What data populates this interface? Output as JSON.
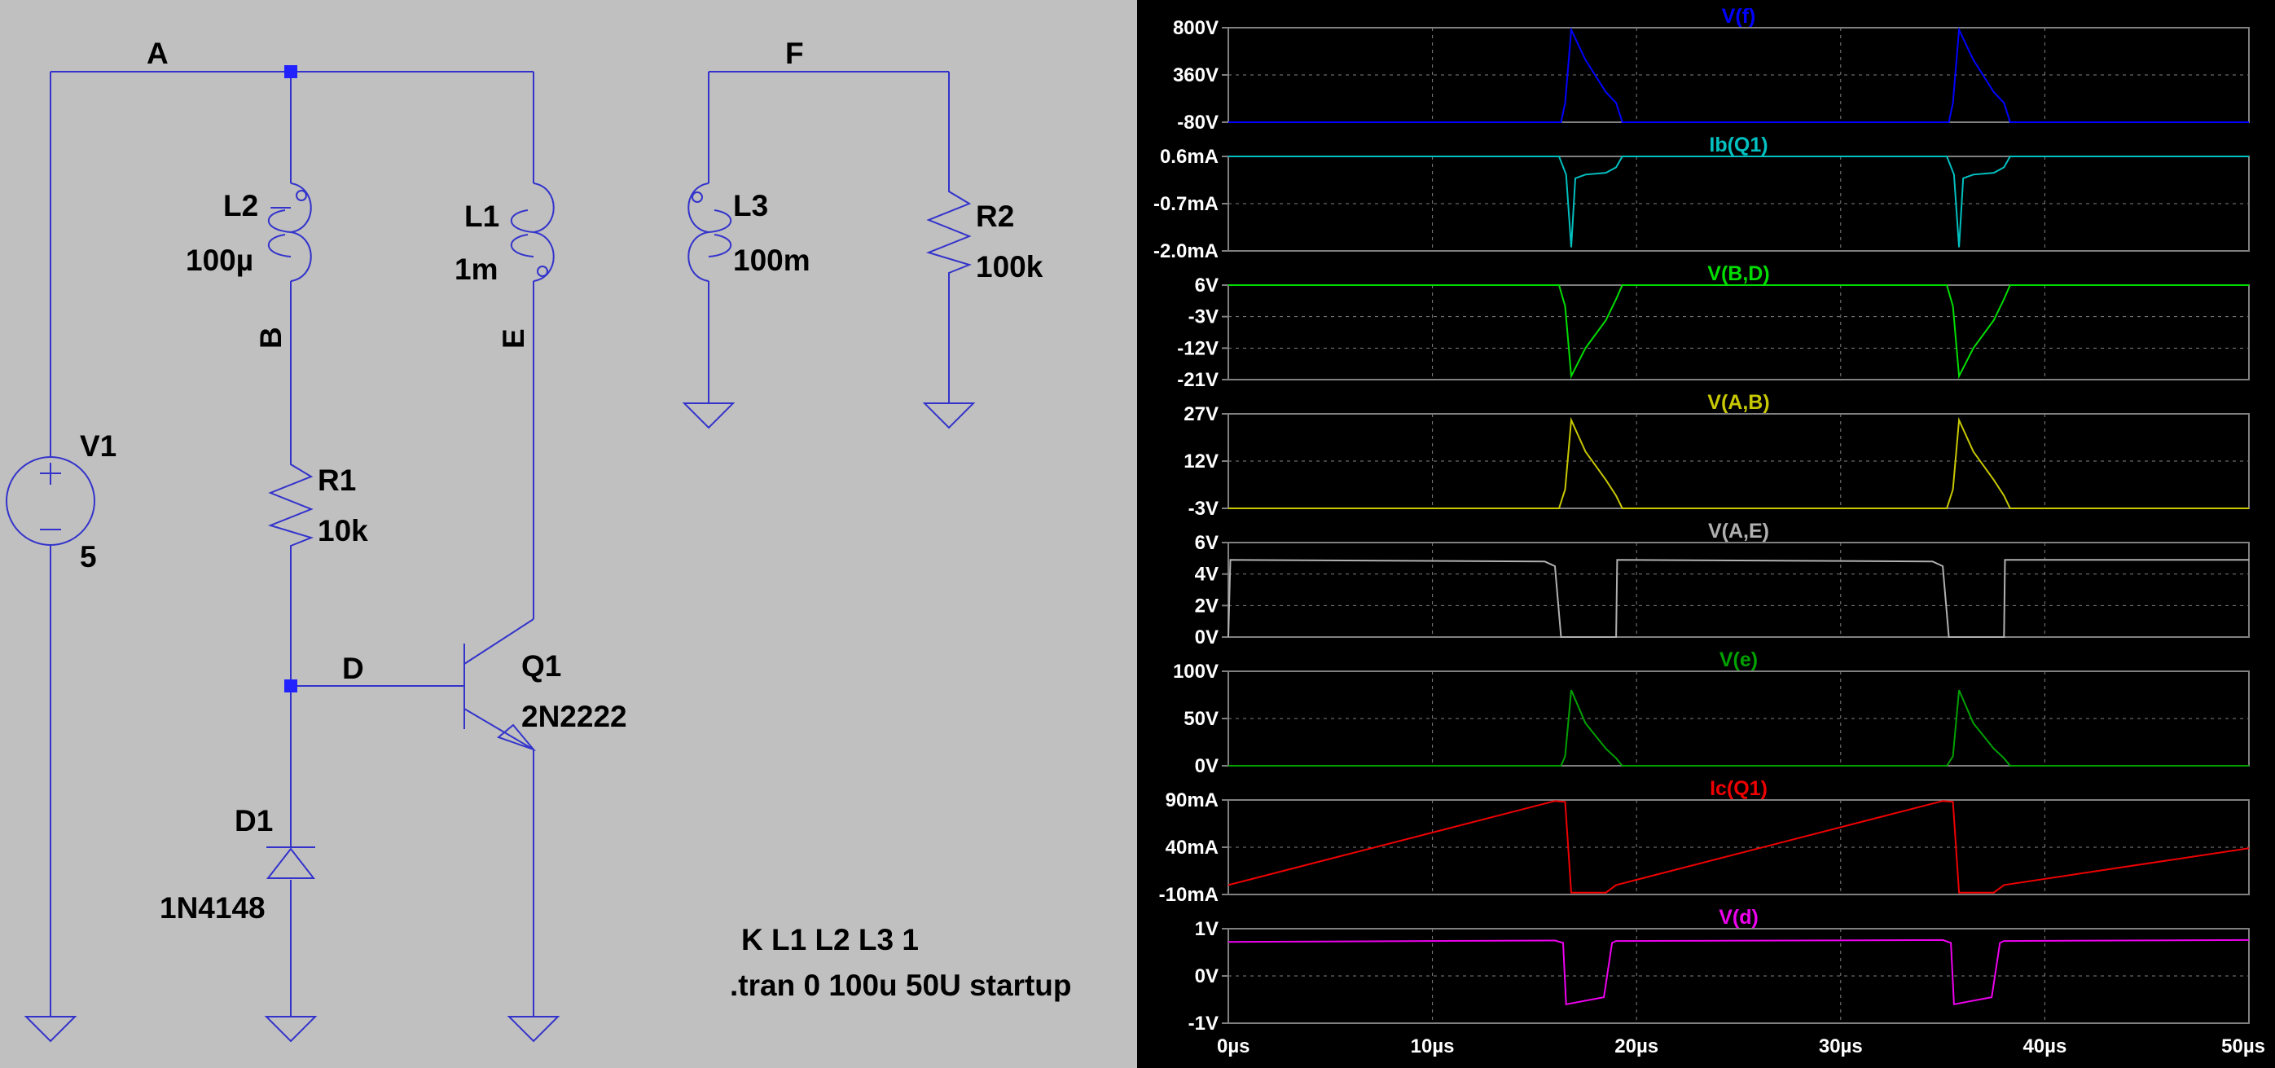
{
  "schematic": {
    "nets": {
      "a": "A",
      "b": "B",
      "d": "D",
      "e": "E",
      "f": "F"
    },
    "components": {
      "v1": {
        "name": "V1",
        "value": "5"
      },
      "l2": {
        "name": "L2",
        "value": "100µ"
      },
      "l1": {
        "name": "L1",
        "value": "1m"
      },
      "l3": {
        "name": "L3",
        "value": "100m"
      },
      "r1": {
        "name": "R1",
        "value": "10k"
      },
      "r2": {
        "name": "R2",
        "value": "100k"
      },
      "q1": {
        "name": "Q1",
        "value": "2N2222"
      },
      "d1": {
        "name": "D1",
        "value": "1N4148"
      }
    },
    "directives": [
      "K L1 L2 L3 1",
      ".tran 0 100u 50U startup"
    ]
  },
  "colors": {
    "schematic_bg": "#c0c0c0",
    "wire": "#3333cc",
    "plot_bg": "#000000",
    "grid": "#808080"
  },
  "chart_data": {
    "type": "line",
    "xlim": [
      0,
      50
    ],
    "x_ticks": [
      "0µs",
      "10µs",
      "20µs",
      "30µs",
      "40µs",
      "50µs"
    ],
    "x_tick_values": [
      0,
      10,
      20,
      30,
      40,
      50
    ],
    "panes": [
      {
        "title": "V(f)",
        "color": "#0000ff",
        "ylim": [
          -80,
          800
        ],
        "y_ticks": [
          "800V",
          "360V",
          "-80V"
        ],
        "y_tick_values": [
          800,
          360,
          -80
        ],
        "x": [
          0,
          16.3,
          16.5,
          16.8,
          17.5,
          18.5,
          19.0,
          19.3,
          35.0,
          35.3,
          35.5,
          35.8,
          36.5,
          37.5,
          38.0,
          38.3,
          50
        ],
        "y": [
          -80,
          -80,
          100,
          780,
          500,
          200,
          100,
          -80,
          -80,
          -80,
          100,
          780,
          500,
          200,
          100,
          -80,
          -80
        ]
      },
      {
        "title": "Ib(Q1)",
        "color": "#00c0c0",
        "ylim": [
          -2.0,
          0.6
        ],
        "y_ticks": [
          "0.6mA",
          "-0.7mA",
          "-2.0mA"
        ],
        "y_tick_values": [
          0.6,
          -0.7,
          -2.0
        ],
        "x": [
          0,
          16.2,
          16.55,
          16.8,
          17.0,
          17.5,
          18.5,
          19.0,
          19.3,
          35.2,
          35.55,
          35.8,
          36.0,
          36.5,
          37.5,
          38.0,
          38.3,
          50
        ],
        "y": [
          0.6,
          0.6,
          0.1,
          -1.9,
          0.0,
          0.1,
          0.15,
          0.3,
          0.6,
          0.6,
          0.1,
          -1.9,
          0.0,
          0.1,
          0.15,
          0.3,
          0.6,
          0.6
        ]
      },
      {
        "title": "V(B,D)",
        "color": "#00dd00",
        "ylim": [
          -21,
          6
        ],
        "y_ticks": [
          "6V",
          "-3V",
          "-12V",
          "-21V"
        ],
        "y_tick_values": [
          6,
          -3,
          -12,
          -21
        ],
        "x": [
          0,
          16.2,
          16.5,
          16.8,
          17.5,
          18.5,
          19.0,
          19.3,
          35.2,
          35.5,
          35.8,
          36.5,
          37.5,
          38.0,
          38.3,
          50
        ],
        "y": [
          6,
          6,
          0,
          -20,
          -12,
          -4,
          2,
          6,
          6,
          0,
          -20,
          -12,
          -4,
          2,
          6,
          6
        ]
      },
      {
        "title": "V(A,B)",
        "color": "#c8c800",
        "ylim": [
          -3,
          27
        ],
        "y_ticks": [
          "27V",
          "12V",
          "-3V"
        ],
        "y_tick_values": [
          27,
          12,
          -3
        ],
        "x": [
          0,
          16.2,
          16.5,
          16.8,
          17.5,
          18.5,
          19.0,
          19.3,
          35.2,
          35.5,
          35.8,
          36.5,
          37.5,
          38.0,
          38.3,
          50
        ],
        "y": [
          -3,
          -3,
          3,
          25,
          15,
          6,
          1,
          -3,
          -3,
          3,
          25,
          15,
          6,
          1,
          -3,
          -3
        ]
      },
      {
        "title": "V(A,E)",
        "color": "#b0b0b0",
        "ylim": [
          0,
          6
        ],
        "y_ticks": [
          "6V",
          "4V",
          "2V",
          "0V"
        ],
        "y_tick_values": [
          6,
          4,
          2,
          0
        ],
        "x": [
          0,
          0.1,
          15.5,
          16.0,
          16.3,
          19.0,
          19.05,
          34.5,
          35.0,
          35.3,
          38.0,
          38.05,
          50
        ],
        "y": [
          0,
          4.9,
          4.8,
          4.5,
          0,
          0,
          4.9,
          4.8,
          4.5,
          0,
          0,
          4.9,
          4.9
        ]
      },
      {
        "title": "V(e)",
        "color": "#00a000",
        "ylim": [
          0,
          100
        ],
        "y_ticks": [
          "100V",
          "50V",
          "0V"
        ],
        "y_tick_values": [
          100,
          50,
          0
        ],
        "x": [
          0,
          16.3,
          16.5,
          16.8,
          17.5,
          18.5,
          19.0,
          19.3,
          35.2,
          35.5,
          35.8,
          36.5,
          37.5,
          38.0,
          38.3,
          50
        ],
        "y": [
          0,
          0,
          10,
          80,
          45,
          18,
          8,
          0,
          0,
          10,
          80,
          45,
          18,
          8,
          0,
          0
        ]
      },
      {
        "title": "Ic(Q1)",
        "color": "#ee0000",
        "ylim": [
          -10,
          90
        ],
        "y_ticks": [
          "90mA",
          "40mA",
          "-10mA"
        ],
        "y_tick_values": [
          90,
          40,
          -10
        ],
        "x": [
          0,
          16.0,
          16.5,
          16.8,
          18.5,
          19.0,
          35.0,
          35.5,
          35.8,
          37.5,
          38.0,
          50
        ],
        "y": [
          0,
          89,
          88,
          -8,
          -8,
          0,
          89,
          88,
          -8,
          -8,
          0,
          39
        ]
      },
      {
        "title": "V(d)",
        "color": "#ee00ee",
        "ylim": [
          -1,
          1
        ],
        "y_ticks": [
          "1V",
          "0V",
          "-1V"
        ],
        "y_tick_values": [
          1,
          0,
          -1
        ],
        "x": [
          0,
          16.0,
          16.4,
          16.55,
          18.4,
          18.8,
          19.0,
          35.0,
          35.4,
          35.55,
          37.4,
          37.8,
          38.0,
          50
        ],
        "y": [
          0.72,
          0.75,
          0.7,
          -0.6,
          -0.45,
          0.7,
          0.74,
          0.76,
          0.7,
          -0.6,
          -0.45,
          0.7,
          0.74,
          0.76
        ]
      }
    ]
  }
}
